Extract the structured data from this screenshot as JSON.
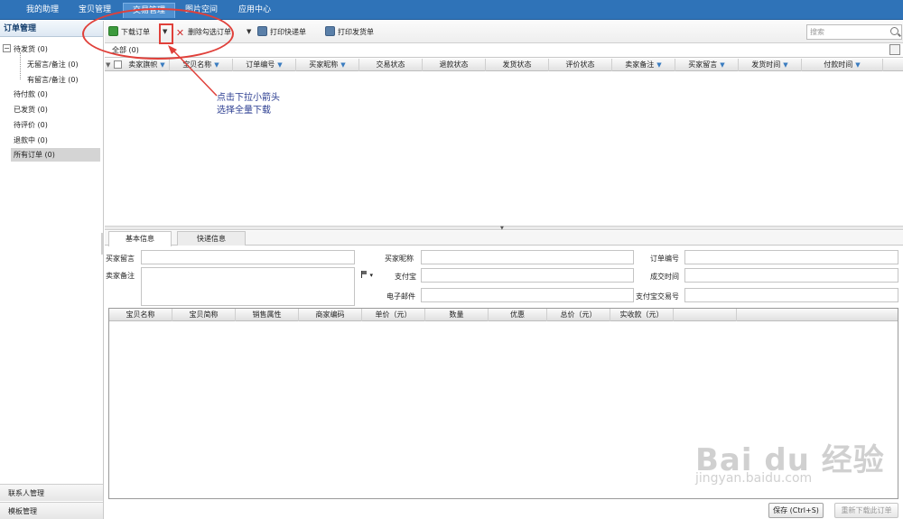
{
  "nav": {
    "tabs": [
      "我的助理",
      "宝贝管理",
      "交易管理",
      "图片空间",
      "应用中心"
    ],
    "active": "交易管理"
  },
  "sidebar": {
    "title": "订单管理",
    "tree": [
      {
        "label": "待发货 (0)"
      },
      {
        "label": "无留言/备注 (0)"
      },
      {
        "label": "有留言/备注 (0)"
      },
      {
        "label": "待付款 (0)"
      },
      {
        "label": "已发货 (0)"
      },
      {
        "label": "待评价 (0)"
      },
      {
        "label": "退款中 (0)"
      },
      {
        "label": "所有订单 (0)"
      }
    ],
    "tree_toggle": "−",
    "bottom": [
      "联系人管理",
      "模板管理"
    ]
  },
  "toolbar": {
    "download": "下载订单",
    "delete_checked": "删除勾选订单",
    "print_express": "打印快递单",
    "print_delivery": "打印发货单",
    "search_placeholder": "搜索"
  },
  "all_tab": "全部 (0)",
  "grid_columns": [
    "卖家旗帜",
    "宝贝名称",
    "订单编号",
    "买家昵称",
    "交易状态",
    "退款状态",
    "发货状态",
    "评价状态",
    "卖家备注",
    "买家留言",
    "发货时间",
    "付款时间"
  ],
  "detail_tabs": [
    "基本信息",
    "快递信息"
  ],
  "form": {
    "buyer_message": "买家留言",
    "seller_note": "卖家备注",
    "buyer_nick": "买家昵称",
    "alipay": "支付宝",
    "email": "电子邮件",
    "order_no": "订单编号",
    "deal_time": "成交时间",
    "alipay_trade_no": "支付宝交易号"
  },
  "items_columns": [
    "宝贝名称",
    "宝贝简称",
    "销售属性",
    "商家编码",
    "单价（元）",
    "数量",
    "优惠",
    "总价（元）",
    "实收款（元）"
  ],
  "buttons": {
    "save": "保存 (Ctrl+S)",
    "redownload": "重新下载此订单"
  },
  "annotation": {
    "line1": "点击下拉小箭头",
    "line2": "选择全量下载",
    "color": "#e0403a"
  },
  "watermark": {
    "brand": "Bai du 经验",
    "url": "jingyan.baidu.com"
  }
}
